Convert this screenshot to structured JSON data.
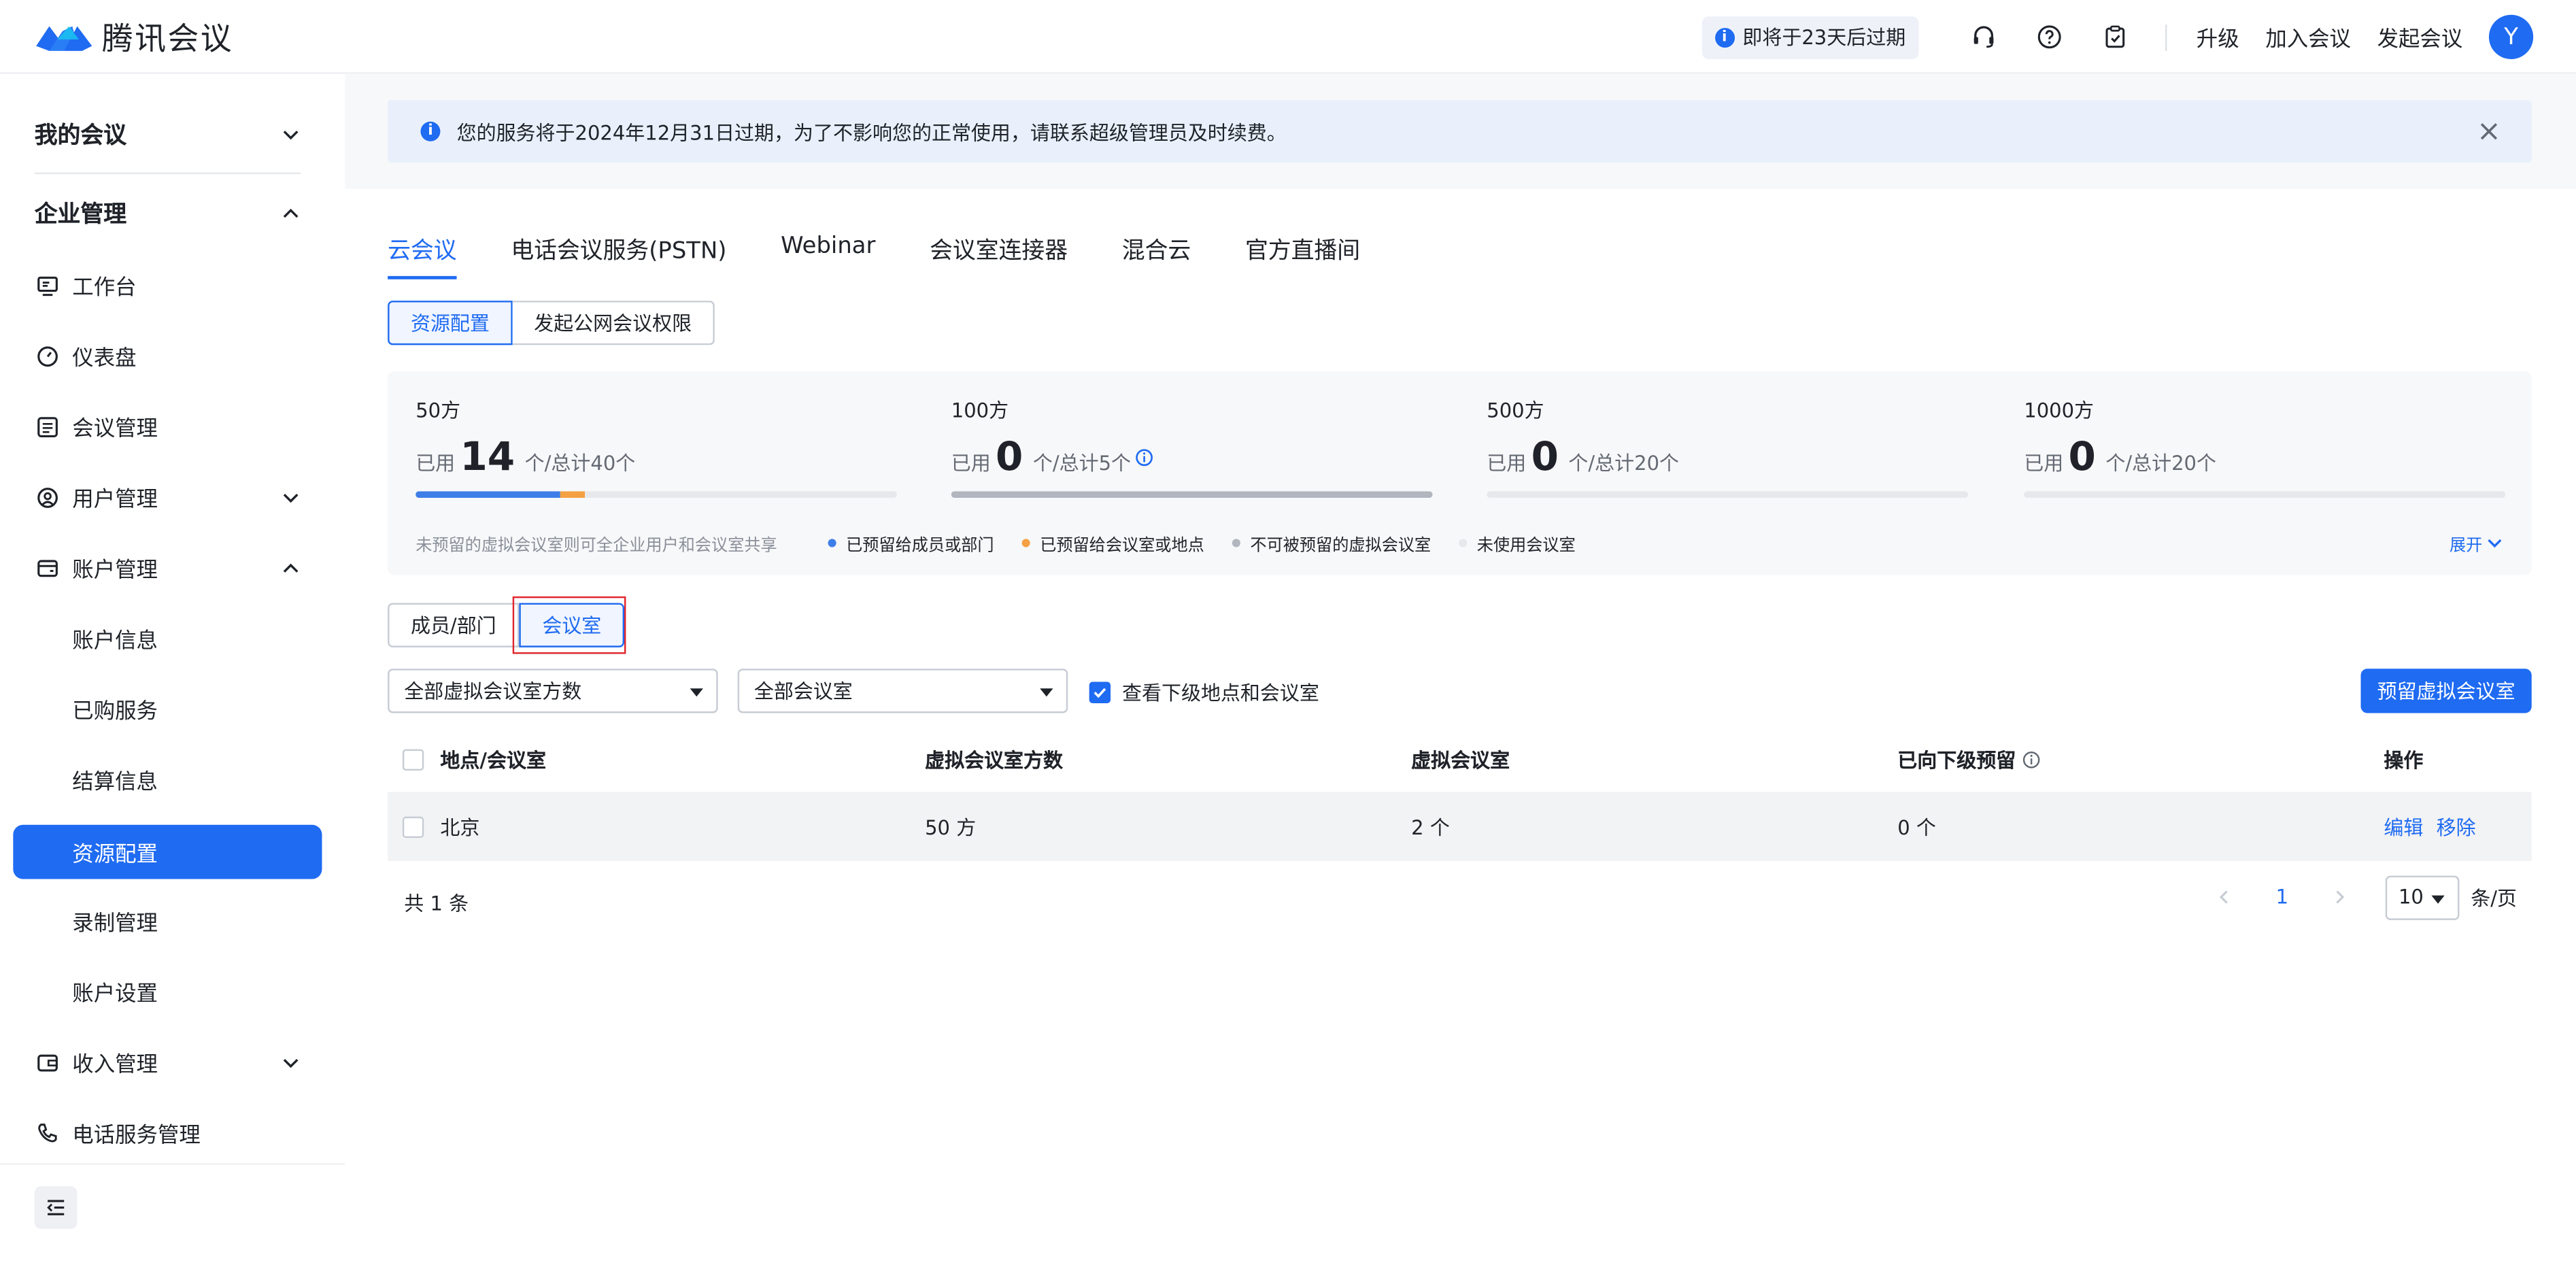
{
  "header": {
    "logo_text": "腾讯会议",
    "expire_notice": "即将于23天后过期",
    "links": [
      "升级",
      "加入会议",
      "发起会议"
    ],
    "avatar_letter": "Y",
    "icons": [
      "headset-icon",
      "help-icon",
      "clipboard-icon"
    ]
  },
  "sidebar": {
    "groups": [
      {
        "label": "我的会议",
        "expanded": false
      },
      {
        "label": "企业管理",
        "expanded": true
      }
    ],
    "items": [
      {
        "label": "工作台",
        "icon": "workbench-icon"
      },
      {
        "label": "仪表盘",
        "icon": "dashboard-icon"
      },
      {
        "label": "会议管理",
        "icon": "meeting-list-icon"
      },
      {
        "label": "用户管理",
        "icon": "user-icon",
        "chevron": "down"
      },
      {
        "label": "账户管理",
        "icon": "wallet-icon",
        "chevron": "up"
      },
      {
        "label": "收入管理",
        "icon": "income-icon",
        "chevron": "down"
      },
      {
        "label": "电话服务管理",
        "icon": "phone-icon"
      }
    ],
    "account_sub": [
      "账户信息",
      "已购服务",
      "结算信息",
      "资源配置",
      "录制管理",
      "账户设置"
    ],
    "active_sub": "资源配置"
  },
  "alert": {
    "text": "您的服务将于2024年12月31日过期，为了不影响您的正常使用，请联系超级管理员及时续费。"
  },
  "tabs": [
    "云会议",
    "电话会议服务(PSTN)",
    "Webinar",
    "会议室连接器",
    "混合云",
    "官方直播间"
  ],
  "active_tab": "云会议",
  "sub_segment": {
    "options": [
      "资源配置",
      "发起公网会议权限"
    ],
    "active": "资源配置"
  },
  "stats": [
    {
      "title": "50方",
      "used_label": "已用",
      "used": "14",
      "total": "个/总计40个",
      "bar": {
        "members": 0.3,
        "rooms": 0.05,
        "virtual": 0.0
      }
    },
    {
      "title": "100方",
      "used_label": "已用",
      "used": "0",
      "total": "个/总计5个",
      "info": true,
      "bar": {
        "members": 0,
        "rooms": 0,
        "virtual": 1.0
      }
    },
    {
      "title": "500方",
      "used_label": "已用",
      "used": "0",
      "total": "个/总计20个",
      "bar": {
        "members": 0,
        "rooms": 0,
        "virtual": 0
      }
    },
    {
      "title": "1000方",
      "used_label": "已用",
      "used": "0",
      "total": "个/总计20个",
      "bar": {
        "members": 0,
        "rooms": 0,
        "virtual": 0
      }
    }
  ],
  "legend": {
    "note": "未预留的虚拟会议室则可全企业用户和会议室共享",
    "items": [
      {
        "label": "已预留给成员或部门",
        "color": "#3d7ee8"
      },
      {
        "label": "已预留给会议室或地点",
        "color": "#f5a042"
      },
      {
        "label": "不可被预留的虚拟会议室",
        "color": "#b1b6bf"
      },
      {
        "label": "未使用会议室",
        "color": "#e6e8eb"
      }
    ],
    "expand": "展开"
  },
  "view_toggle": {
    "options": [
      "成员/部门",
      "会议室"
    ],
    "active": "会议室"
  },
  "filters": {
    "size_select": "全部虚拟会议室方数",
    "room_select": "全部会议室",
    "include_sub_label": "查看下级地点和会议室",
    "include_sub_checked": true,
    "primary_button": "预留虚拟会议室"
  },
  "table": {
    "columns": [
      "地点/会议室",
      "虚拟会议室方数",
      "虚拟会议室",
      "已向下级预留",
      "操作"
    ],
    "rows": [
      {
        "location": "北京",
        "size": "50 方",
        "rooms": "2 个",
        "reserved": "0 个",
        "actions": [
          "编辑",
          "移除"
        ]
      }
    ]
  },
  "pagination": {
    "total": "共 1 条",
    "current": "1",
    "page_size": "10",
    "per_page": "条/页"
  }
}
